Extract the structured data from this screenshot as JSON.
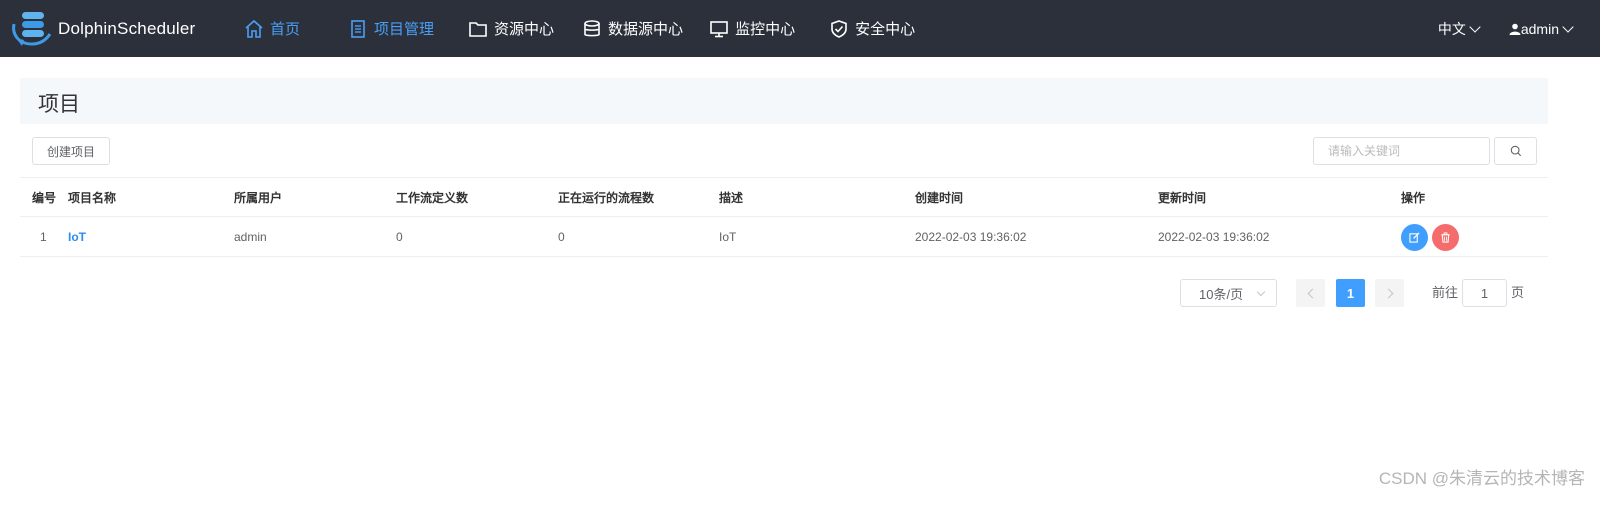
{
  "app": {
    "name": "DolphinScheduler"
  },
  "nav": {
    "items": [
      {
        "label": "首页",
        "icon": "home-icon"
      },
      {
        "label": "项目管理",
        "icon": "document-icon"
      },
      {
        "label": "资源中心",
        "icon": "folder-icon"
      },
      {
        "label": "数据源中心",
        "icon": "database-icon"
      },
      {
        "label": "监控中心",
        "icon": "monitor-icon"
      },
      {
        "label": "安全中心",
        "icon": "shield-icon"
      }
    ],
    "active_color": "#4a9ff5",
    "language": "中文",
    "user": "admin"
  },
  "page": {
    "title": "项目"
  },
  "toolbar": {
    "create_label": "创建项目",
    "search_placeholder": "请输入关键词"
  },
  "table": {
    "headers": [
      "编号",
      "项目名称",
      "所属用户",
      "工作流定义数",
      "正在运行的流程数",
      "描述",
      "创建时间",
      "更新时间",
      "操作"
    ],
    "rows": [
      {
        "id": "1",
        "name": "IoT",
        "owner": "admin",
        "workflow_count": "0",
        "running_count": "0",
        "description": "IoT",
        "create_time": "2022-02-03 19:36:02",
        "update_time": "2022-02-03 19:36:02"
      }
    ]
  },
  "pagination": {
    "page_size": "10条/页",
    "current_page": "1",
    "goto_label": "前往",
    "goto_value": "1",
    "goto_suffix": "页"
  },
  "watermark": "CSDN @朱清云的技术博客",
  "colors": {
    "topbar": "#2b303b",
    "primary": "#409eff",
    "danger": "#f56c6c",
    "link": "#2d8cf0"
  }
}
